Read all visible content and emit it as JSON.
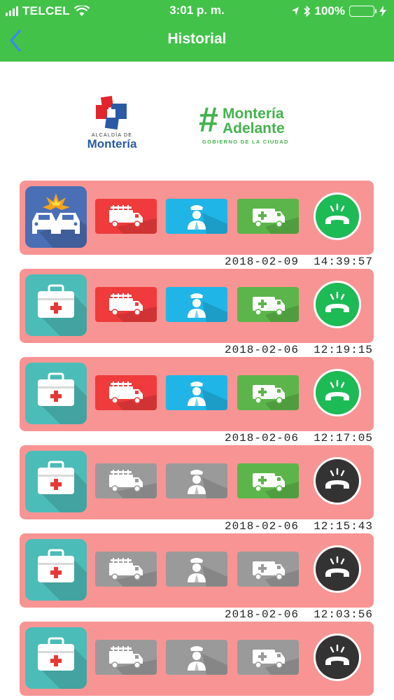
{
  "status_bar": {
    "carrier": "TELCEL",
    "time": "3:01 p. m.",
    "battery_percent": "100%"
  },
  "nav": {
    "title": "Historial",
    "back_icon": "chevron-left-icon"
  },
  "logos": {
    "alcaldia_small": "ALCALDÍA DE",
    "alcaldia_big": "Montería",
    "adelante_hash": "#",
    "adelante_line1": "Montería",
    "adelante_line2": "Adelante",
    "adelante_sub": "GOBIERNO DE LA CIUDAD"
  },
  "colors": {
    "header_green": "#43c24a",
    "card_pink": "#f89494",
    "fire_red": "#ef3b3b",
    "police_blue": "#1fb5e6",
    "ambulance_green": "#5cb54a",
    "inactive_gray": "#9a9a9a",
    "call_active": "#1cbb55",
    "call_inactive": "#333333",
    "accident_blue": "#4a6fb5",
    "medical_teal": "#4cbcb8"
  },
  "records": [
    {
      "category": "accident",
      "fire": true,
      "police": true,
      "ambulance": true,
      "call_answered": true,
      "date": "2018-02-09",
      "time": "14:39:57"
    },
    {
      "category": "medical",
      "fire": true,
      "police": true,
      "ambulance": true,
      "call_answered": true,
      "date": "2018-02-06",
      "time": "12:19:15"
    },
    {
      "category": "medical",
      "fire": true,
      "police": true,
      "ambulance": true,
      "call_answered": true,
      "date": "2018-02-06",
      "time": "12:17:05"
    },
    {
      "category": "medical",
      "fire": false,
      "police": false,
      "ambulance": true,
      "call_answered": false,
      "date": "2018-02-06",
      "time": "12:15:43"
    },
    {
      "category": "medical",
      "fire": false,
      "police": false,
      "ambulance": false,
      "call_answered": false,
      "date": "2018-02-06",
      "time": "12:03:56"
    },
    {
      "category": "medical",
      "fire": false,
      "police": false,
      "ambulance": false,
      "call_answered": false,
      "date": "",
      "time": ""
    }
  ]
}
